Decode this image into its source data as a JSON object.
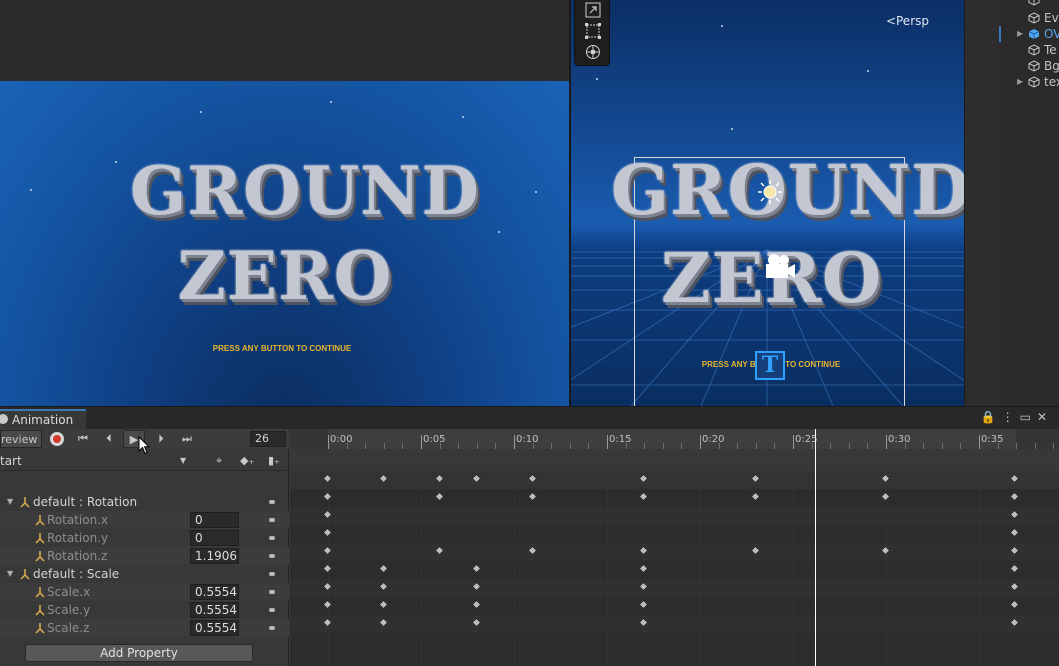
{
  "scene": {
    "persp_label": "Persp",
    "tools": [
      "expand-icon",
      "rect-icon",
      "transform-icon"
    ]
  },
  "game": {
    "title_line1": "GROUND",
    "title_line2": "ZERO",
    "press_text": "PRESS ANY BUTTON TO CONTINUE"
  },
  "hierarchy": {
    "items": [
      {
        "label": "Ev",
        "selected": false,
        "expandable": false
      },
      {
        "label": "OV",
        "selected": true,
        "expandable": true
      },
      {
        "label": "Te",
        "selected": false,
        "expandable": false
      },
      {
        "label": "Bg",
        "selected": false,
        "expandable": false
      },
      {
        "label": "tex",
        "selected": false,
        "expandable": true
      }
    ]
  },
  "animation": {
    "tab_label": "Animation",
    "preview_label": "review",
    "frame_value": "26",
    "clip_name": "tart",
    "add_property_label": "Add Property",
    "properties": [
      {
        "label": "default : Rotation",
        "value": "",
        "group": true
      },
      {
        "label": "Rotation.x",
        "value": "0",
        "group": false
      },
      {
        "label": "Rotation.y",
        "value": "0",
        "group": false
      },
      {
        "label": "Rotation.z",
        "value": "1.1906",
        "group": false
      },
      {
        "label": "default : Scale",
        "value": "",
        "group": true
      },
      {
        "label": "Scale.x",
        "value": "0.5554",
        "group": false
      },
      {
        "label": "Scale.y",
        "value": "0.5554",
        "group": false
      },
      {
        "label": "Scale.z",
        "value": "0.5554",
        "group": false
      }
    ],
    "time_labels": [
      "0:00",
      "0:05",
      "0:10",
      "0:15",
      "0:20",
      "0:25",
      "0:30",
      "0:35"
    ]
  },
  "colors": {
    "accent": "#3a79bb",
    "record": "#d23b2a",
    "press_text": "#e8b52a"
  }
}
